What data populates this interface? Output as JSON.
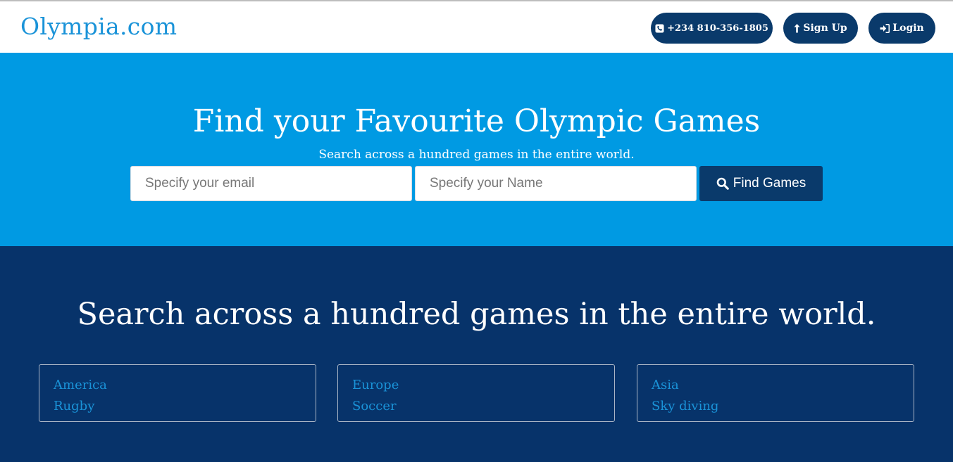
{
  "header": {
    "brand": "Olympia.com",
    "phone_label": "+234 810-356-1805",
    "signup_label": "Sign Up",
    "login_label": "Login"
  },
  "hero": {
    "title": "Find your Favourite Olympic Games",
    "subtitle": "Search across a hundred games in the entire world.",
    "email_placeholder": "Specify your email",
    "name_placeholder": "Specify your Name",
    "find_button_label": "Find Games"
  },
  "games": {
    "title": "Search across a hundred games in the entire world.",
    "cards": [
      {
        "region": "America",
        "sport": "Rugby"
      },
      {
        "region": "Europe",
        "sport": "Soccer"
      },
      {
        "region": "Asia",
        "sport": "Sky diving"
      }
    ]
  },
  "colors": {
    "brand": "#1a93d8",
    "navy": "#0a3a6b",
    "hero_bg": "#009ae3",
    "lower_bg": "#07336a"
  },
  "icons": {
    "phone": "phone-square-icon",
    "signup": "arrow-up-icon",
    "login": "sign-in-icon",
    "search": "search-icon"
  }
}
